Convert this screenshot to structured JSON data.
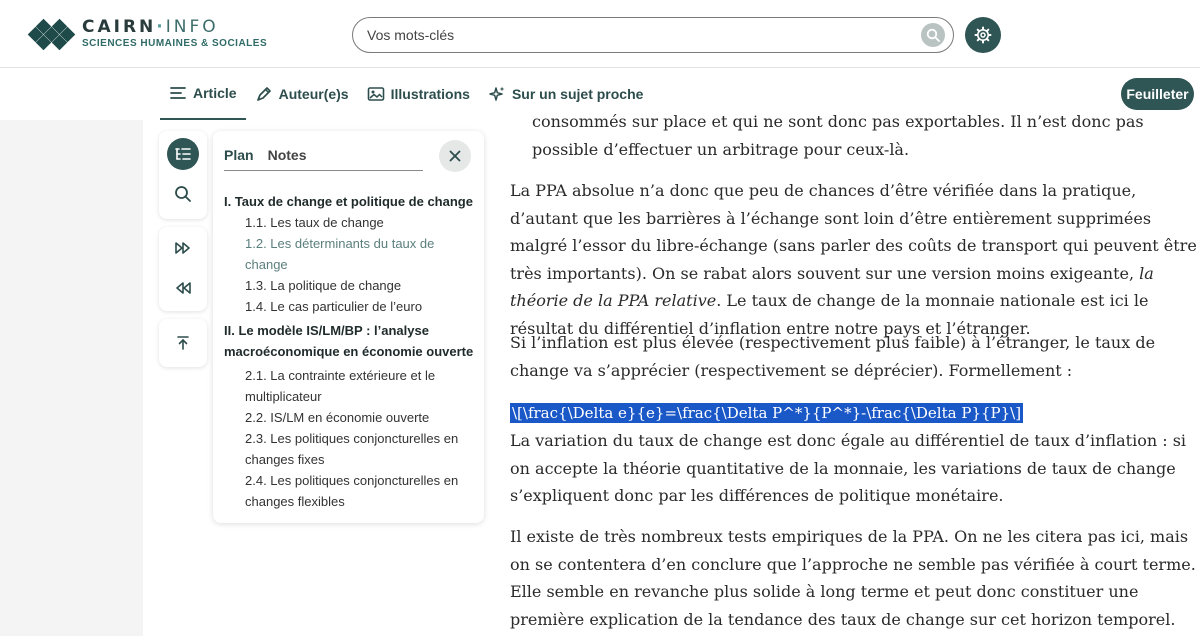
{
  "header": {
    "logo_name": "CAIRN",
    "logo_dot": "·",
    "logo_info": "INFO",
    "logo_sub": "SCIENCES HUMAINES & SOCIALES",
    "search_placeholder": "Vos mots-clés"
  },
  "tabs": [
    {
      "label": "Article",
      "icon": "list-icon"
    },
    {
      "label": "Auteur(e)s",
      "icon": "pen-icon"
    },
    {
      "label": "Illustrations",
      "icon": "image-icon"
    },
    {
      "label": "Sur un sujet proche",
      "icon": "sparkle-icon"
    }
  ],
  "feuilleter_label": "Feuilleter",
  "panel": {
    "tab_plan": "Plan",
    "tab_notes": "Notes",
    "sections": [
      {
        "title": "I. Taux de change et politique de change",
        "items": [
          "1.1. Les taux de change",
          "1.2. Les déterminants du taux de change",
          "1.3. La politique de change",
          "1.4. Le cas particulier de l’euro"
        ]
      },
      {
        "title": "II. Le modèle IS/LM/BP : l’analyse macroéconomique en économie ouverte",
        "items": [
          "2.1. La contrainte extérieure et le multiplicateur",
          "2.2. IS/LM en économie ouverte",
          "2.3. Les politiques conjoncturelles en changes fixes",
          "2.4. Les politiques conjoncturelles en changes flexibles"
        ]
      }
    ]
  },
  "article": {
    "quote_text": "consommés sur place et qui ne sont donc pas exportables. Il n’est donc pas possible d’effectuer un arbitrage pour ceux-là.",
    "p1_a": "La PPA absolue n’a donc que peu de chances d’être vérifiée dans la pratique, d’autant que les barrières à l’échange sont loin d’être entièrement supprimées malgré l’essor du libre-échange (sans parler des coûts de transport qui peuvent être très importants). On se rabat alors souvent sur une version moins exigeante, ",
    "p1_em": "la théorie de la PPA relative",
    "p1_b": ". Le taux de change de la monnaie nationale est ici le résultat du différentiel d’inflation entre notre pays et l’étranger.",
    "p2": "Si l’inflation est plus élevée (respectivement plus faible) à l’étranger, le taux de change va s’apprécier (respectivement se déprécier). Formellement :",
    "formula": "\\[\\frac{\\Delta e}{e}=\\frac{\\Delta P^*}{P^*}-\\frac{\\Delta P}{P}\\]",
    "p3": "La variation du taux de change est donc égale au différentiel de taux d’inflation : si on accepte la théorie quantitative de la monnaie, les variations de taux de change s’expliquent donc par les différences de politique monétaire.",
    "p4": "Il existe de très nombreux tests empiriques de la PPA. On ne les citera pas ici, mais on se contentera d’en conclure que l’approche ne semble pas vérifiée à court terme. Elle semble en revanche plus solide à long terme et peut donc constituer une première explication de la tendance des taux de change sur cet horizon temporel."
  },
  "colors": {
    "brand": "#2f5554",
    "accent": "#5b7f7d",
    "selection": "#1a57c7"
  }
}
